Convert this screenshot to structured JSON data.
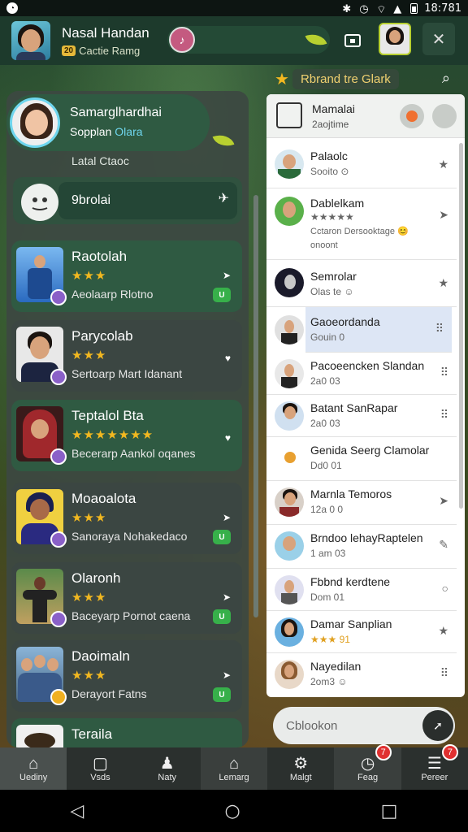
{
  "statusbar": {
    "time": "18:781"
  },
  "header": {
    "name": "Nasal Handan",
    "tag": "20",
    "sub": "Cactie Ramg"
  },
  "profile": {
    "name": "Samarglhardhai",
    "sub_plain": "Sopplan ",
    "sub_highlight": "Olara",
    "caption": "Latal Ctaoc"
  },
  "search": {
    "label": "9brolai"
  },
  "cards": [
    {
      "title": "Raotolah",
      "stars": "★★★",
      "desc": "Aeolaarp Rlotno",
      "badge": "U"
    },
    {
      "title": "Parycolab",
      "stars": "★★★",
      "desc": "Sertoarp Mart Idanant",
      "badge": ""
    },
    {
      "title": "Teptalol Bta",
      "stars": "★★★★★★★",
      "desc": "Becerarp Aankol oqanes",
      "badge": ""
    },
    {
      "title": "Moaoalota",
      "stars": "★★★",
      "desc": "Sanoraya Nohakedaco",
      "badge": "U"
    },
    {
      "title": "Olaronh",
      "stars": "★★★",
      "desc": "Baceyarp Pornot caena",
      "badge": "U"
    },
    {
      "title": "Daoimaln",
      "stars": "★★★",
      "desc": "Derayort Fatns",
      "badge": "U"
    },
    {
      "title": "Teraila",
      "stars": "",
      "desc": "",
      "badge": ""
    }
  ],
  "right_top": {
    "title": "Rbrand tre Glark"
  },
  "right_head": {
    "title": "Mamalai",
    "sub": "2aojtime"
  },
  "contacts": [
    {
      "name": "Palaolc",
      "sub": "Sooito ⊙"
    },
    {
      "name": "Dablelkam",
      "sub": "★★★★★",
      "sub2": "Cctaron Dersooktage 😊",
      "sub3": "onoont"
    },
    {
      "name": "Semrolar",
      "sub": "Olas  te ☺"
    },
    {
      "name": "Gaoeordanda",
      "sub": "Gouin 0"
    },
    {
      "name": "Pacoeencken Slandan",
      "sub": "2a0 03"
    },
    {
      "name": "Batant SanRapar",
      "sub": "2a0 03"
    },
    {
      "name": "Genida Seerg Clamolar",
      "sub": "Dd0 01"
    },
    {
      "name": "Marnla Temoros",
      "sub": "12a 0 0"
    },
    {
      "name": "Brndoo lehayRaptelen",
      "sub": "1 am 03"
    },
    {
      "name": "Fbbnd kerdtene",
      "sub": "Dom 01"
    },
    {
      "name": "Damar Sanplian",
      "sub": "★★★ 91"
    },
    {
      "name": "Nayedilan",
      "sub": "2om3 ☺"
    }
  ],
  "composer": {
    "placeholder": "Cblookon"
  },
  "nav": [
    {
      "label": "Uediny",
      "icon": "home-icon",
      "badge": ""
    },
    {
      "label": "Vsds",
      "icon": "tablet-icon",
      "badge": ""
    },
    {
      "label": "Naty",
      "icon": "person-icon",
      "badge": ""
    },
    {
      "label": "Lemarg",
      "icon": "house-icon",
      "badge": ""
    },
    {
      "label": "Malgt",
      "icon": "gear-icon",
      "badge": ""
    },
    {
      "label": "Feag",
      "icon": "clock-icon",
      "badge": "7"
    },
    {
      "label": "Pereer",
      "icon": "menu-icon",
      "badge": "7"
    }
  ]
}
